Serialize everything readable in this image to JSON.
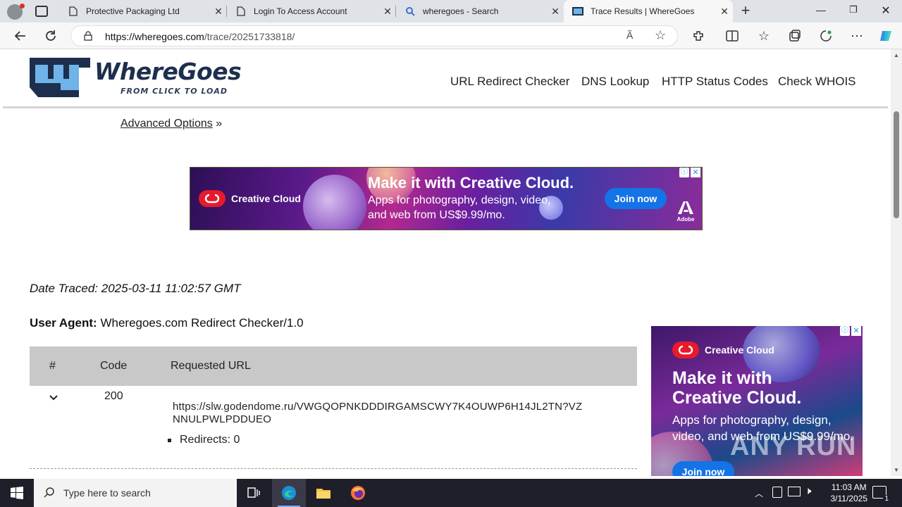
{
  "browser": {
    "tabs": [
      {
        "title": "Protective Packaging Ltd",
        "icon": "page-icon"
      },
      {
        "title": "Login To Access Account",
        "icon": "page-icon"
      },
      {
        "title": "wheregoes - Search",
        "icon": "search-icon"
      },
      {
        "title": "Trace Results | WhereGoes",
        "icon": "wheregoes-favicon",
        "active": true
      }
    ],
    "url_host": "https://wheregoes.com",
    "url_path": "/trace/20251733818/"
  },
  "site": {
    "logo_text": "WhereGoes",
    "logo_tagline": "FROM CLICK TO LOAD",
    "nav": [
      "URL Redirect Checker",
      "DNS Lookup",
      "HTTP Status Codes",
      "Check WHOIS"
    ],
    "advanced_link": "Advanced Options",
    "advanced_suffix": "»"
  },
  "ad_top": {
    "brand": "Creative Cloud",
    "headline": "Make it with Creative Cloud.",
    "body": "Apps for photography, design, video, and web from US$9.99/mo.",
    "cta": "Join now",
    "vendor": "Adobe"
  },
  "ad_side": {
    "brand": "Creative Cloud",
    "headline": "Make it with Creative Cloud.",
    "body": "Apps for photography, design, video, and web from US$9.99/mo.",
    "cta": "Join now",
    "watermark": "ANY RUN"
  },
  "trace": {
    "date_label": "Date Traced:",
    "date_value": "2025-03-11 11:02:57 GMT",
    "ua_label": "User Agent:",
    "ua_value": "Wheregoes.com Redirect Checker/1.0",
    "columns": [
      "#",
      "Code",
      "Requested URL"
    ],
    "rows": [
      {
        "code": "200",
        "url_line1": "https://slw.godendome.ru/VWGQOPNKDDDIRGAMSCWY7K4OUWP6H14JL2TN?VZ",
        "url_line2": "NNULPWLPDDUEO",
        "redirects": "Redirects: 0"
      }
    ]
  },
  "taskbar": {
    "search_placeholder": "Type here to search",
    "time": "11:03 AM",
    "date": "3/11/2025",
    "notification_count": "1"
  }
}
